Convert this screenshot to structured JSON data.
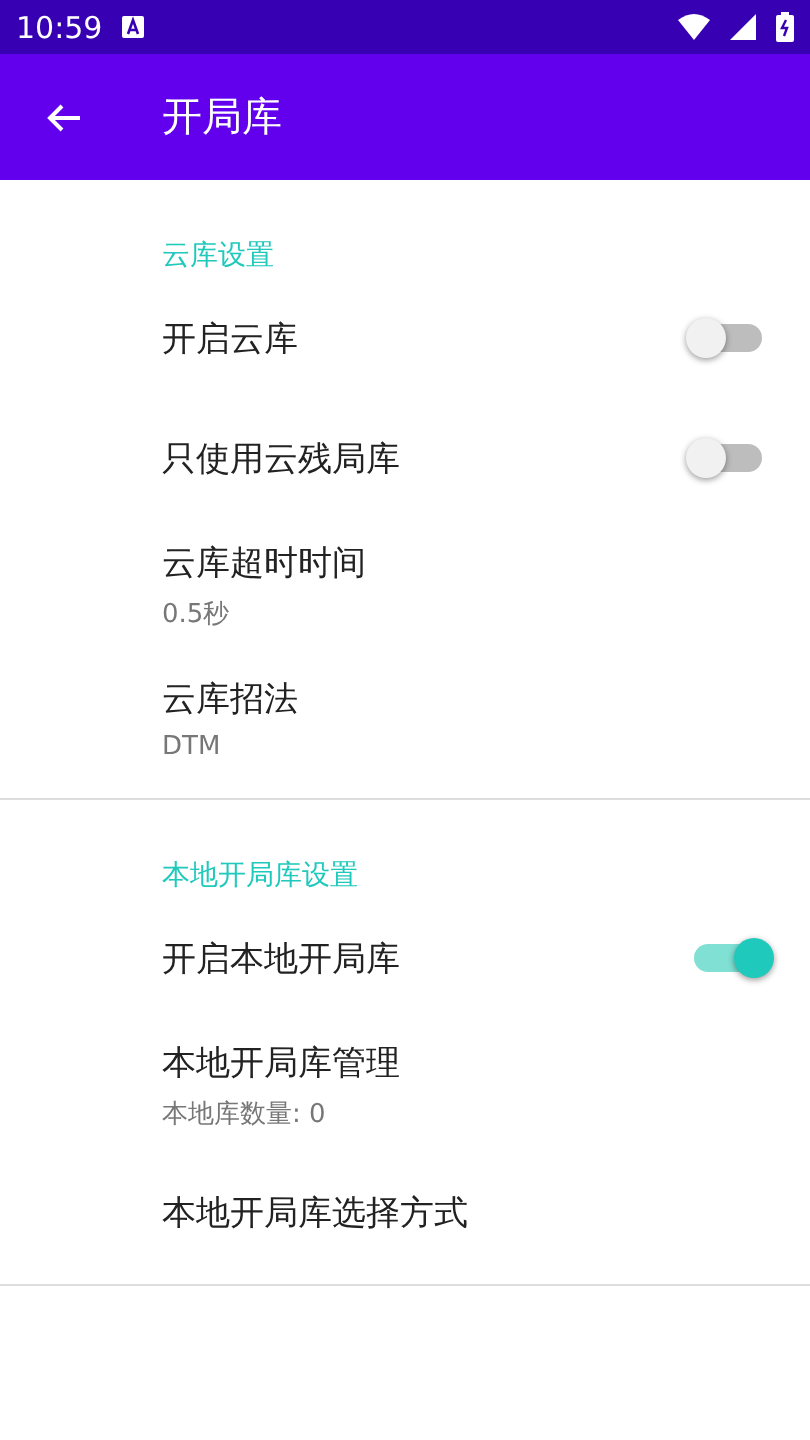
{
  "status_bar": {
    "time": "10:59"
  },
  "toolbar": {
    "title": "开局库"
  },
  "sections": [
    {
      "title": "云库设置",
      "items": [
        {
          "kind": "switch",
          "title": "开启云库",
          "on": false
        },
        {
          "kind": "switch",
          "title": "只使用云残局库",
          "on": false
        },
        {
          "kind": "text",
          "title": "云库超时时间",
          "summary": "0.5秒"
        },
        {
          "kind": "text",
          "title": "云库招法",
          "summary": "DTM"
        }
      ]
    },
    {
      "title": "本地开局库设置",
      "items": [
        {
          "kind": "switch",
          "title": "开启本地开局库",
          "on": true
        },
        {
          "kind": "text",
          "title": "本地开局库管理",
          "summary": "本地库数量: 0"
        },
        {
          "kind": "text",
          "title": "本地开局库选择方式"
        }
      ]
    }
  ]
}
